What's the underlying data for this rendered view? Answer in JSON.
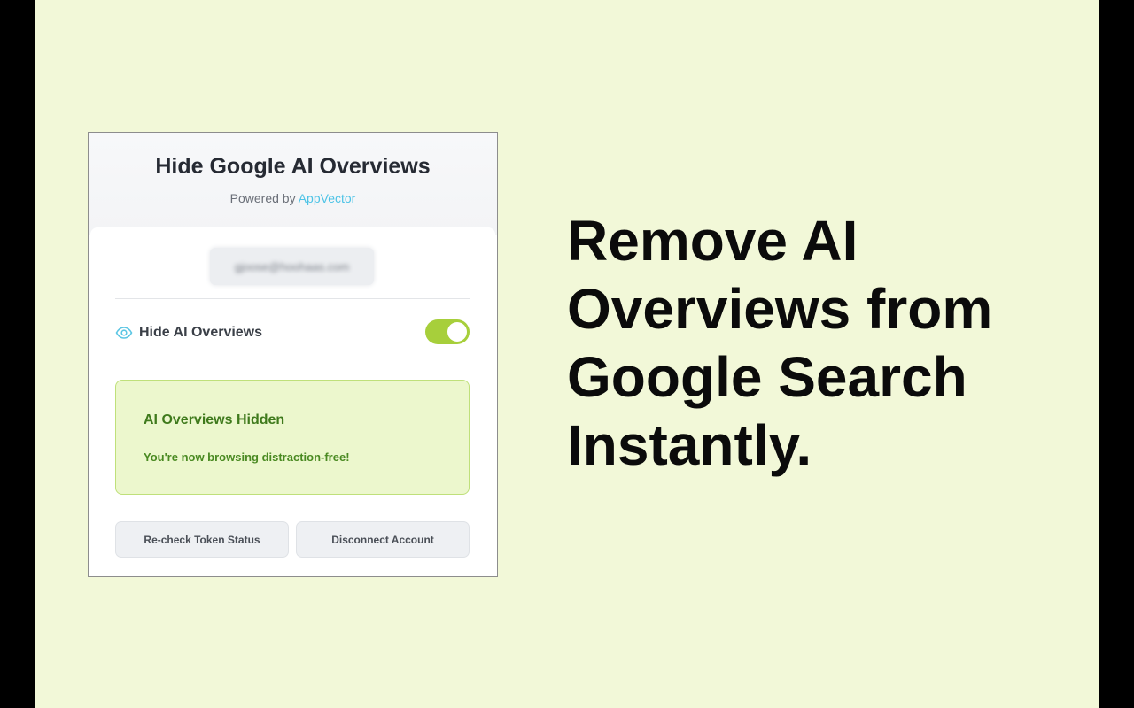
{
  "popup": {
    "title": "Hide Google AI Overviews",
    "powered_prefix": "Powered by",
    "powered_brand": "AppVector",
    "email": "gjoose@hoohaas.com",
    "toggle": {
      "label": "Hide AI Overviews",
      "on": true
    },
    "status": {
      "title": "AI Overviews Hidden",
      "message": "You're now browsing distraction-free!"
    },
    "buttons": {
      "recheck": "Re-check Token Status",
      "disconnect": "Disconnect Account"
    }
  },
  "headline": {
    "line1": "Remove AI",
    "line2": "Overviews from",
    "line3": "Google Search",
    "line4": "Instantly."
  },
  "colors": {
    "stage_background": "#f2f8d8",
    "brand": "#4cc3e6",
    "toggle_on": "#a7cf3b",
    "status_text": "#3f7a1c",
    "status_background": "#ecf7cd"
  },
  "icons": {
    "toggle_icon": "eye-icon"
  }
}
